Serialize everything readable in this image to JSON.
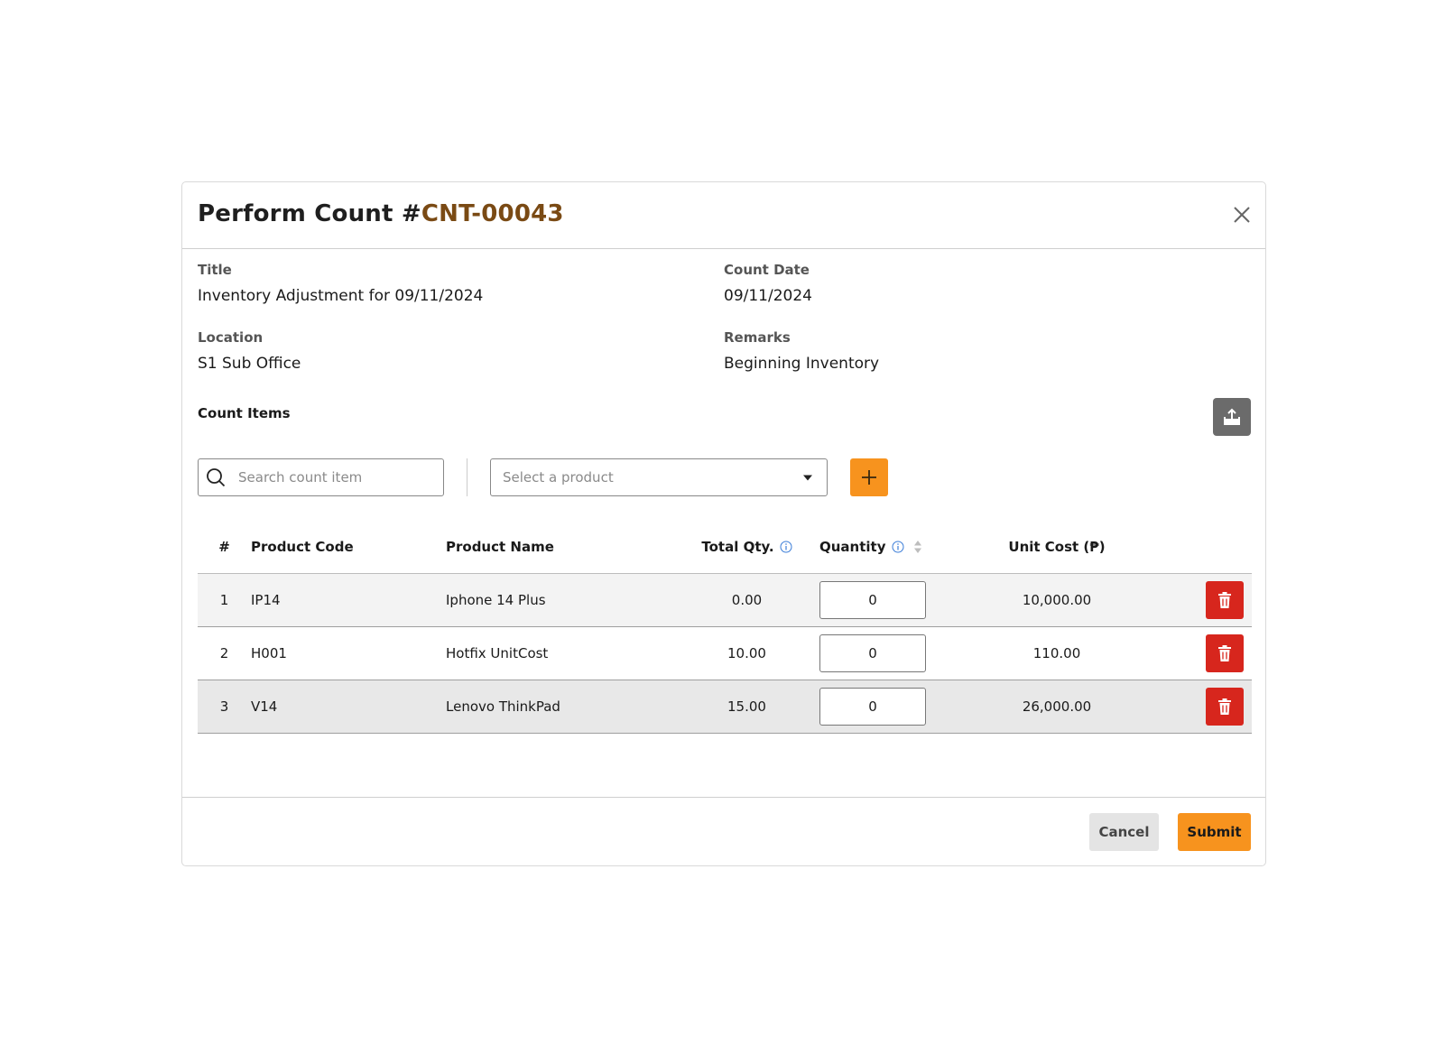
{
  "header": {
    "title_prefix": "Perform Count #",
    "count_code": "CNT-00043"
  },
  "details": {
    "title_label": "Title",
    "title_value": "Inventory Adjustment for 09/11/2024",
    "count_date_label": "Count Date",
    "count_date_value": "09/11/2024",
    "location_label": "Location",
    "location_value": "S1 Sub Office",
    "remarks_label": "Remarks",
    "remarks_value": "Beginning Inventory"
  },
  "count_items": {
    "section_title": "Count Items",
    "search_placeholder": "Search count item",
    "product_select_placeholder": "Select a product"
  },
  "table": {
    "columns": {
      "num": "#",
      "code": "Product Code",
      "name": "Product Name",
      "total": "Total Qty.",
      "qty": "Quantity",
      "cost": "Unit Cost (₱)"
    },
    "rows": [
      {
        "num": "1",
        "code": "IP14",
        "name": "Iphone 14 Plus",
        "total": "0.00",
        "qty": "0",
        "cost": "10,000.00"
      },
      {
        "num": "2",
        "code": "H001",
        "name": "Hotfix UnitCost",
        "total": "10.00",
        "qty": "0",
        "cost": "110.00"
      },
      {
        "num": "3",
        "code": "V14",
        "name": "Lenovo ThinkPad",
        "total": "15.00",
        "qty": "0",
        "cost": "26,000.00"
      }
    ]
  },
  "footer": {
    "cancel_label": "Cancel",
    "submit_label": "Submit"
  },
  "colors": {
    "accent": "#f7931e",
    "code_brown": "#7a4a14",
    "danger": "#d7261d",
    "upload_gray": "#6b6b6b",
    "info_blue": "#3b7dd8"
  },
  "icons": {
    "close": "close-icon",
    "upload": "upload-icon",
    "search": "search-icon",
    "caret": "caret-down-icon",
    "add": "plus-icon",
    "info": "info-icon",
    "sort": "sort-icon",
    "delete": "trash-icon"
  }
}
